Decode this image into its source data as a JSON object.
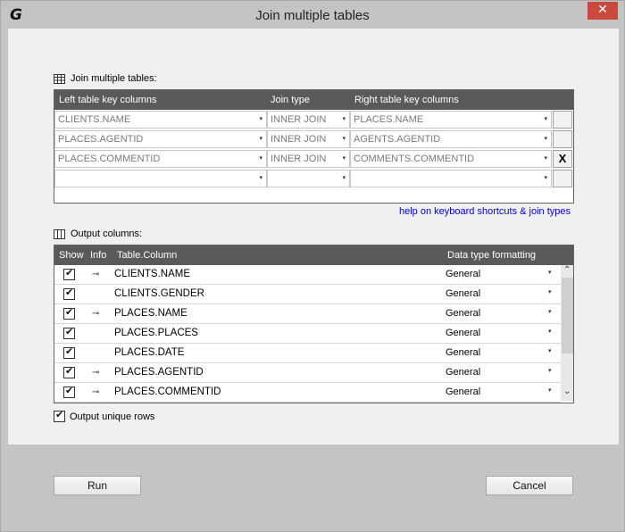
{
  "window": {
    "title": "Join multiple tables",
    "logo": "G",
    "close_glyph": "✕"
  },
  "join_section": {
    "label": "Join multiple tables:",
    "columns": [
      "Left table key columns",
      "Join type",
      "Right table key columns"
    ],
    "rows": [
      {
        "left": "CLIENTS.NAME",
        "join": "INNER JOIN",
        "right": "PLACES.NAME",
        "action": ""
      },
      {
        "left": "PLACES.AGENTID",
        "join": "INNER JOIN",
        "right": "AGENTS.AGENTID",
        "action": ""
      },
      {
        "left": "PLACES.COMMENTID",
        "join": "INNER JOIN",
        "right": "COMMENTS.COMMENTID",
        "action": "X"
      },
      {
        "left": "",
        "join": "",
        "right": "",
        "action": ""
      }
    ],
    "help_link": "help on keyboard shortcuts & join types"
  },
  "output_section": {
    "label": "Output columns:",
    "columns": [
      "Show",
      "Info",
      "Table.Column",
      "Data type formatting"
    ],
    "rows": [
      {
        "show": true,
        "key": true,
        "name": "CLIENTS.NAME",
        "format": "General"
      },
      {
        "show": true,
        "key": false,
        "name": "CLIENTS.GENDER",
        "format": "General"
      },
      {
        "show": true,
        "key": true,
        "name": "PLACES.NAME",
        "format": "General"
      },
      {
        "show": true,
        "key": false,
        "name": "PLACES.PLACES",
        "format": "General"
      },
      {
        "show": true,
        "key": false,
        "name": "PLACES.DATE",
        "format": "General"
      },
      {
        "show": true,
        "key": true,
        "name": "PLACES.AGENTID",
        "format": "General"
      },
      {
        "show": true,
        "key": true,
        "name": "PLACES.COMMENTID",
        "format": "General"
      }
    ],
    "unique_rows_label": "Output unique rows",
    "unique_rows_checked": true
  },
  "buttons": {
    "run": "Run",
    "cancel": "Cancel"
  },
  "icons": {
    "dropdown": "▾",
    "key": "⊸",
    "scroll_up": "⌃",
    "scroll_down": "⌄"
  }
}
